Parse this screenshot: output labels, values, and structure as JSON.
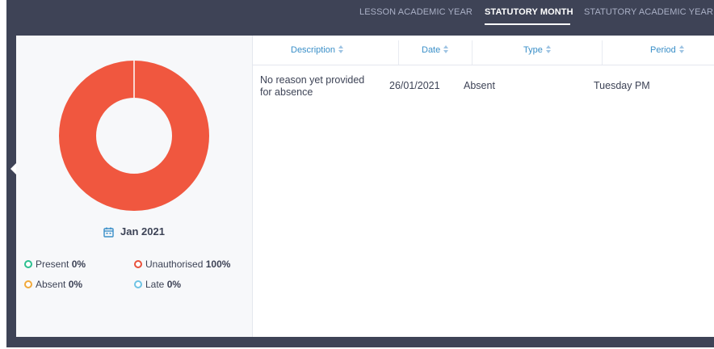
{
  "tabs": [
    {
      "label": "LESSON ACADEMIC YEAR",
      "active": false
    },
    {
      "label": "STATUTORY MONTH",
      "active": true
    },
    {
      "label": "STATUTORY ACADEMIC YEAR",
      "active": false
    }
  ],
  "summary": {
    "month_label": "Jan 2021",
    "calendar_icon": "calendar-icon",
    "chart_segments": [
      {
        "name": "Unauthorised",
        "fraction": 1.0,
        "color": "#f0573f"
      }
    ],
    "legend": [
      {
        "label": "Present",
        "value": "0%",
        "color": "#2bbf8f"
      },
      {
        "label": "Unauthorised",
        "value": "100%",
        "color": "#e8503a"
      },
      {
        "label": "Absent",
        "value": "0%",
        "color": "#f1a93a"
      },
      {
        "label": "Late",
        "value": "0%",
        "color": "#6ec3e4"
      }
    ]
  },
  "table": {
    "columns": [
      "Description",
      "Date",
      "Type",
      "Period"
    ],
    "rows": [
      {
        "description_line1": "No reason yet provided",
        "description_line2": "for absence",
        "date": "26/01/2021",
        "type": "Absent",
        "period": "Tuesday PM"
      }
    ]
  },
  "colors": {
    "background_dark": "#3e4356",
    "accent_blue": "#3a8fc8",
    "donut_red": "#f0573f"
  }
}
